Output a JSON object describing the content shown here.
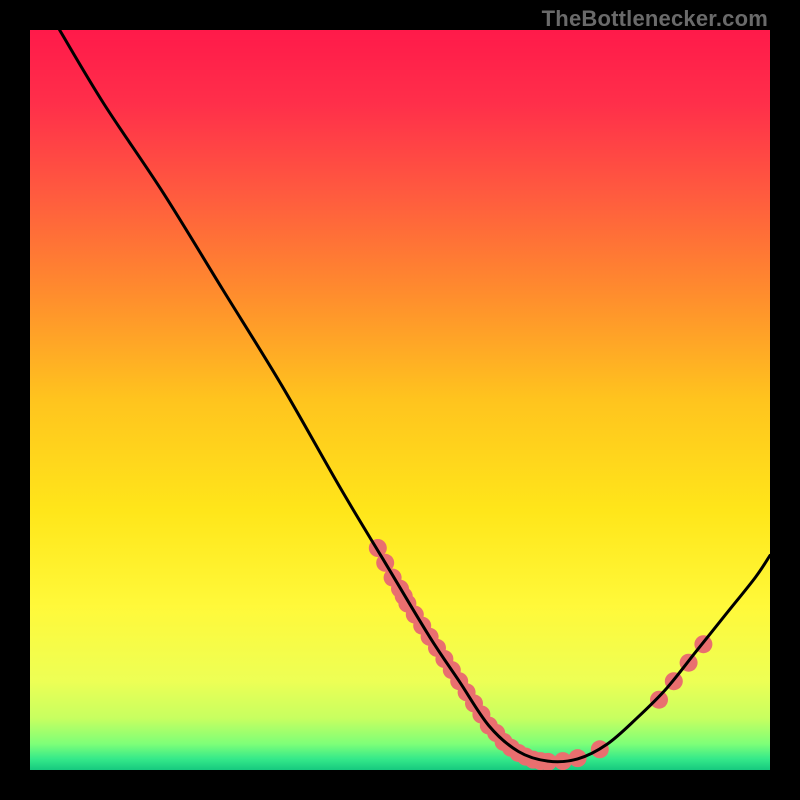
{
  "watermark": "TheBottlenecker.com",
  "chart_data": {
    "type": "line",
    "title": "",
    "xlabel": "",
    "ylabel": "",
    "xlim": [
      0,
      100
    ],
    "ylim": [
      0,
      100
    ],
    "curve": [
      {
        "x": 4,
        "y": 100
      },
      {
        "x": 10,
        "y": 90
      },
      {
        "x": 18,
        "y": 78
      },
      {
        "x": 26,
        "y": 65
      },
      {
        "x": 34,
        "y": 52
      },
      {
        "x": 42,
        "y": 38
      },
      {
        "x": 48,
        "y": 28
      },
      {
        "x": 54,
        "y": 18
      },
      {
        "x": 58,
        "y": 12
      },
      {
        "x": 62,
        "y": 6
      },
      {
        "x": 66,
        "y": 2.5
      },
      {
        "x": 70,
        "y": 1.2
      },
      {
        "x": 74,
        "y": 1.5
      },
      {
        "x": 78,
        "y": 3.5
      },
      {
        "x": 82,
        "y": 7
      },
      {
        "x": 86,
        "y": 11
      },
      {
        "x": 90,
        "y": 16
      },
      {
        "x": 94,
        "y": 21
      },
      {
        "x": 98,
        "y": 26
      },
      {
        "x": 100,
        "y": 29
      }
    ],
    "scatter": [
      {
        "x": 47,
        "y": 30
      },
      {
        "x": 48,
        "y": 28
      },
      {
        "x": 49,
        "y": 26
      },
      {
        "x": 50,
        "y": 24.5
      },
      {
        "x": 50.5,
        "y": 23.5
      },
      {
        "x": 51,
        "y": 22.5
      },
      {
        "x": 52,
        "y": 21
      },
      {
        "x": 53,
        "y": 19.5
      },
      {
        "x": 54,
        "y": 18
      },
      {
        "x": 55,
        "y": 16.5
      },
      {
        "x": 56,
        "y": 15
      },
      {
        "x": 57,
        "y": 13.5
      },
      {
        "x": 58,
        "y": 12
      },
      {
        "x": 59,
        "y": 10.5
      },
      {
        "x": 60,
        "y": 9
      },
      {
        "x": 61,
        "y": 7.5
      },
      {
        "x": 62,
        "y": 6
      },
      {
        "x": 63,
        "y": 5
      },
      {
        "x": 64,
        "y": 3.8
      },
      {
        "x": 65,
        "y": 3
      },
      {
        "x": 66,
        "y": 2.3
      },
      {
        "x": 67,
        "y": 1.8
      },
      {
        "x": 68,
        "y": 1.4
      },
      {
        "x": 69,
        "y": 1.2
      },
      {
        "x": 70,
        "y": 1.1
      },
      {
        "x": 72,
        "y": 1.2
      },
      {
        "x": 74,
        "y": 1.6
      },
      {
        "x": 77,
        "y": 2.8
      },
      {
        "x": 85,
        "y": 9.5
      },
      {
        "x": 87,
        "y": 12
      },
      {
        "x": 89,
        "y": 14.5
      },
      {
        "x": 91,
        "y": 17
      }
    ],
    "gradient_stops": [
      {
        "offset": 0.0,
        "color": "#ff1a4a"
      },
      {
        "offset": 0.1,
        "color": "#ff2f4a"
      },
      {
        "offset": 0.22,
        "color": "#ff5a3f"
      },
      {
        "offset": 0.35,
        "color": "#ff8a2e"
      },
      {
        "offset": 0.5,
        "color": "#ffc41e"
      },
      {
        "offset": 0.65,
        "color": "#ffe61a"
      },
      {
        "offset": 0.78,
        "color": "#fff93a"
      },
      {
        "offset": 0.88,
        "color": "#edff55"
      },
      {
        "offset": 0.93,
        "color": "#c7ff60"
      },
      {
        "offset": 0.965,
        "color": "#7dff78"
      },
      {
        "offset": 0.985,
        "color": "#35e98a"
      },
      {
        "offset": 1.0,
        "color": "#16c97f"
      }
    ],
    "curve_color": "#000000",
    "scatter_color": "#e96f6f",
    "scatter_radius": 9
  }
}
